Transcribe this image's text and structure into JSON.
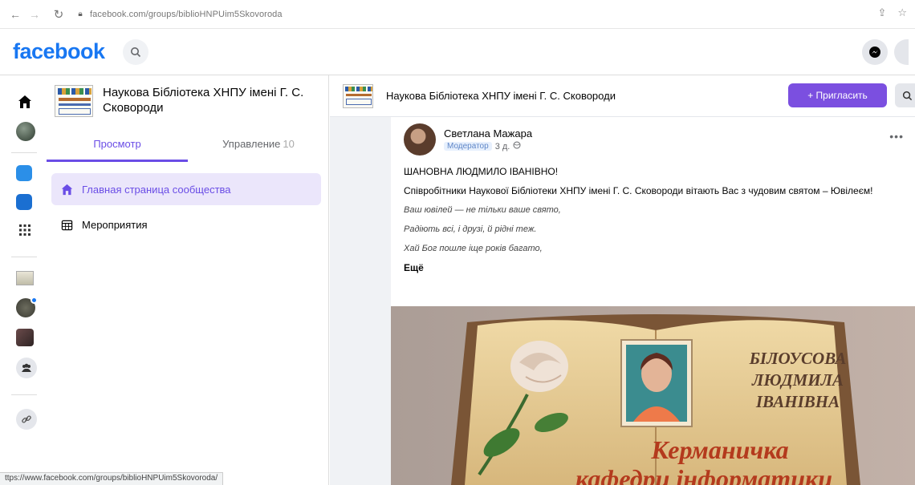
{
  "browser": {
    "url": "facebook.com/groups/biblioHNPUim5Skovoroda",
    "status_url": "ttps://www.facebook.com/groups/biblioHNPUim5Skovoroda/"
  },
  "header": {
    "logo": "facebook"
  },
  "group": {
    "name": "Наукова Бібліотека ХНПУ імені Г. С. Сковороди",
    "tabs": [
      {
        "label": "Просмотр"
      },
      {
        "label": "Управление",
        "count": "10"
      }
    ],
    "nav": [
      {
        "label": "Главная страница сообщества",
        "icon": "home-icon",
        "active": true
      },
      {
        "label": "Мероприятия",
        "icon": "calendar-icon",
        "active": false
      }
    ],
    "invite_label": "+ Пригласить"
  },
  "post": {
    "author": "Светлана Мажара",
    "role": "Модератор",
    "time": "3 д.",
    "greeting": "ШАНОВНА ЛЮДМИЛО ІВАНІВНО!",
    "body": "Співробітники Наукової Бібліотеки ХНПУ імені Г. С. Сковороди вітають Вас з чудовим святом – Ювілеєм!",
    "poem": [
      "Ваш ювілей — не тільки ваше свято,",
      "Радіють всі, і друзі, й рідні теж.",
      "Хай Бог пошле іще років багато,"
    ],
    "more": "Ещё",
    "image": {
      "name_lines": [
        "БІЛОУСОВА",
        "ЛЮДМИЛА",
        "ІВАНІВНА"
      ],
      "caption_lines": [
        "Керманичка",
        "кафедри інформатики"
      ]
    }
  },
  "colors": {
    "fb_blue": "#1877f2",
    "accent_purple": "#6a4de6",
    "invite_bg": "#7b4fe0"
  }
}
